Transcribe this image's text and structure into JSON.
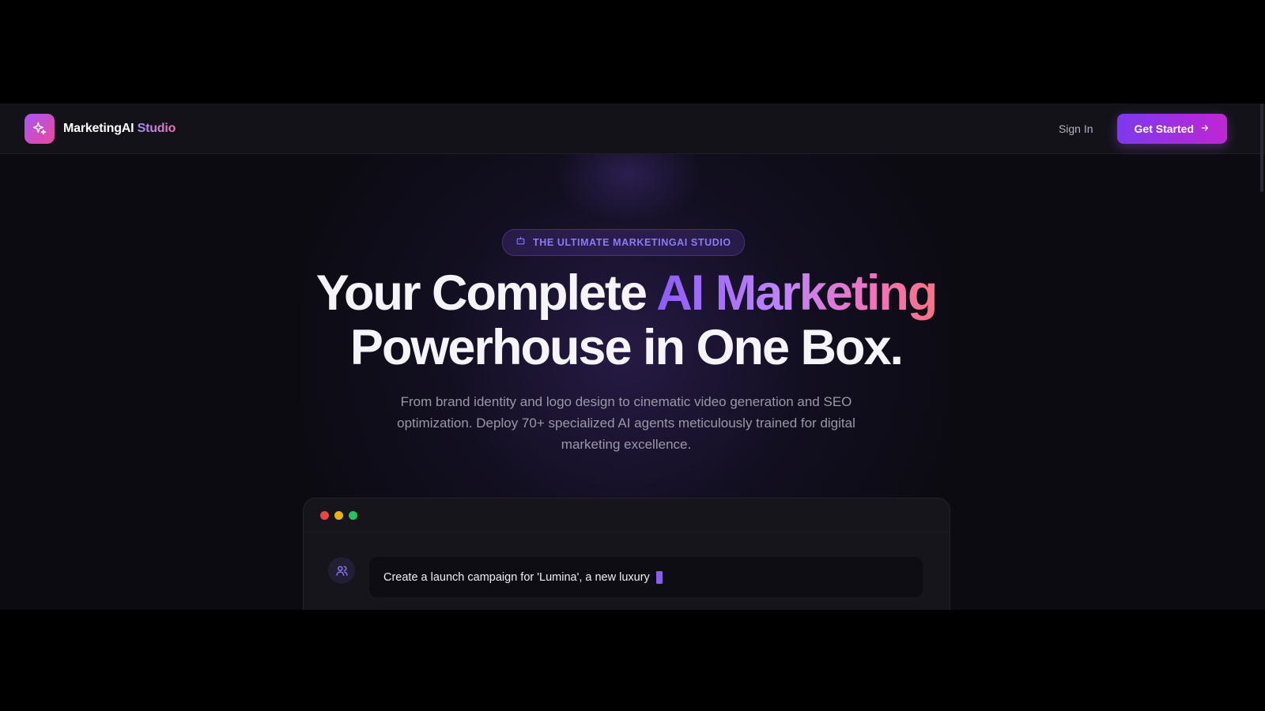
{
  "brand": {
    "name": "MarketingAI",
    "accent": "Studio",
    "icon": "sparkles-icon"
  },
  "nav": {
    "signin": "Sign In",
    "cta": "Get Started",
    "cta_icon": "arrow-right-icon"
  },
  "hero": {
    "badge": "THE ULTIMATE MARKETINGAI STUDIO",
    "badge_icon": "robot-icon",
    "headline_part1": "Your Complete ",
    "headline_accent": "AI Marketing",
    "headline_part2": "Powerhouse in One Box.",
    "subtitle": "From brand identity and logo design to cinematic video generation and SEO optimization. Deploy 70+ specialized AI agents meticulously trained for digital marketing excellence."
  },
  "demo": {
    "window_dots": [
      "#ef4444",
      "#eab308",
      "#22c55e"
    ],
    "user_icon": "users-icon",
    "prompt": "Create a launch campaign for 'Lumina', a new luxury"
  },
  "colors": {
    "accent": "#8b5cf6",
    "brand_gradient_start": "#a855f7",
    "brand_gradient_end": "#ec4899",
    "background": "#0c0b12"
  }
}
